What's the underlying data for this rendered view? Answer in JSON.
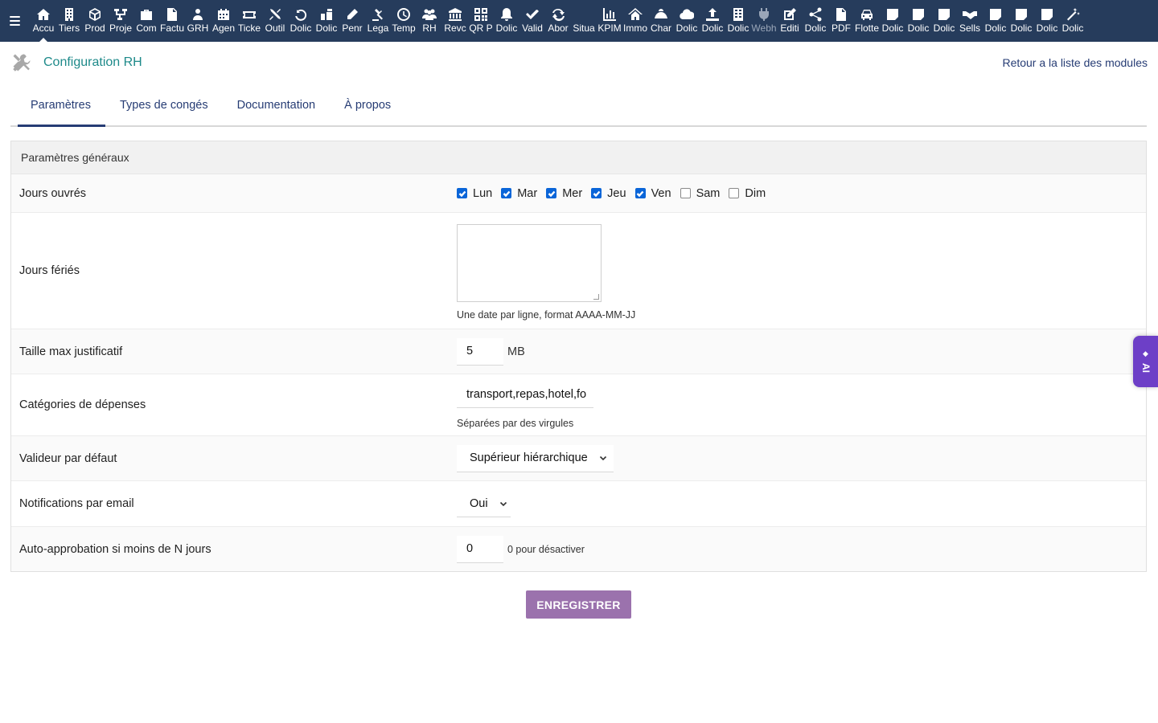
{
  "colors": {
    "topbar": "#263c5c",
    "title": "#1e8a8a",
    "link": "#263c74",
    "button": "#9b72ad",
    "ai_tab": "#6d3fc7",
    "checkbox": "#0a65d8"
  },
  "topbar": {
    "menu_icon": "hamburger-icon",
    "modules": [
      {
        "label": "Accu",
        "icon": "home"
      },
      {
        "label": "Tiers",
        "icon": "building"
      },
      {
        "label": "Prod",
        "icon": "cube"
      },
      {
        "label": "Proje",
        "icon": "sitemap"
      },
      {
        "label": "Com",
        "icon": "briefcase"
      },
      {
        "label": "Factu",
        "icon": "file-invoice"
      },
      {
        "label": "GRH",
        "icon": "users"
      },
      {
        "label": "Agen",
        "icon": "calendar"
      },
      {
        "label": "Ticke",
        "icon": "ticket"
      },
      {
        "label": "Outil",
        "icon": "tools"
      },
      {
        "label": "Dolic",
        "icon": "undo"
      },
      {
        "label": "Dolic",
        "icon": "puzzle"
      },
      {
        "label": "Penr",
        "icon": "pen"
      },
      {
        "label": "Lega",
        "icon": "gavel"
      },
      {
        "label": "Temp",
        "icon": "clock"
      },
      {
        "label": "RH",
        "icon": "people"
      },
      {
        "label": "Revc",
        "icon": "bank"
      },
      {
        "label": "QR P",
        "icon": "qrcode"
      },
      {
        "label": "Dolic",
        "icon": "bell"
      },
      {
        "label": "Valid",
        "icon": "check-double"
      },
      {
        "label": "Abor",
        "icon": "sync"
      },
      {
        "label": "Situa",
        "icon": "blank"
      },
      {
        "label": "KPIM",
        "icon": "chart"
      },
      {
        "label": "Immo",
        "icon": "house"
      },
      {
        "label": "Char",
        "icon": "hill"
      },
      {
        "label": "Dolic",
        "icon": "cloud"
      },
      {
        "label": "Dolic",
        "icon": "upload"
      },
      {
        "label": "Dolic",
        "icon": "building-alt"
      },
      {
        "label": "Webh",
        "icon": "plug"
      },
      {
        "label": "Editi",
        "icon": "edit"
      },
      {
        "label": "Dolic",
        "icon": "share"
      },
      {
        "label": "PDF",
        "icon": "file-pdf"
      },
      {
        "label": "Flotte",
        "icon": "car"
      },
      {
        "label": "Dolic",
        "icon": "note"
      },
      {
        "label": "Dolic",
        "icon": "note"
      },
      {
        "label": "Dolic",
        "icon": "note"
      },
      {
        "label": "Sells",
        "icon": "handshake"
      },
      {
        "label": "Dolic",
        "icon": "note"
      },
      {
        "label": "Dolic",
        "icon": "note"
      },
      {
        "label": "Dolic",
        "icon": "note"
      },
      {
        "label": "Dolic",
        "icon": "magic"
      }
    ]
  },
  "header": {
    "title": "Configuration RH",
    "back_link": "Retour a la liste des modules"
  },
  "tabs": [
    "Paramètres",
    "Types de congés",
    "Documentation",
    "À propos"
  ],
  "panel": {
    "title": "Paramètres généraux",
    "working_days": {
      "label": "Jours ouvrés",
      "days": [
        {
          "label": "Lun",
          "checked": true
        },
        {
          "label": "Mar",
          "checked": true
        },
        {
          "label": "Mer",
          "checked": true
        },
        {
          "label": "Jeu",
          "checked": true
        },
        {
          "label": "Ven",
          "checked": true
        },
        {
          "label": "Sam",
          "checked": false
        },
        {
          "label": "Dim",
          "checked": false
        }
      ]
    },
    "holidays": {
      "label": "Jours fériés",
      "value": "",
      "hint": "Une date par ligne, format AAAA-MM-JJ"
    },
    "max_size": {
      "label": "Taille max justificatif",
      "value": "5",
      "unit": "MB"
    },
    "expense_categories": {
      "label": "Catégories de dépenses",
      "value": "transport,repas,hotel,fo",
      "hint": "Séparées par des virgules"
    },
    "default_validator": {
      "label": "Valideur par défaut",
      "value": "Supérieur hiérarchique"
    },
    "email_notifications": {
      "label": "Notifications par email",
      "value": "Oui"
    },
    "auto_approval": {
      "label": "Auto-approbation si moins de N jours",
      "value": "0",
      "hint": "0 pour désactiver"
    }
  },
  "save_button": "ENREGISTRER",
  "ai_tab": {
    "label": "AI",
    "icon": "sparkle"
  }
}
